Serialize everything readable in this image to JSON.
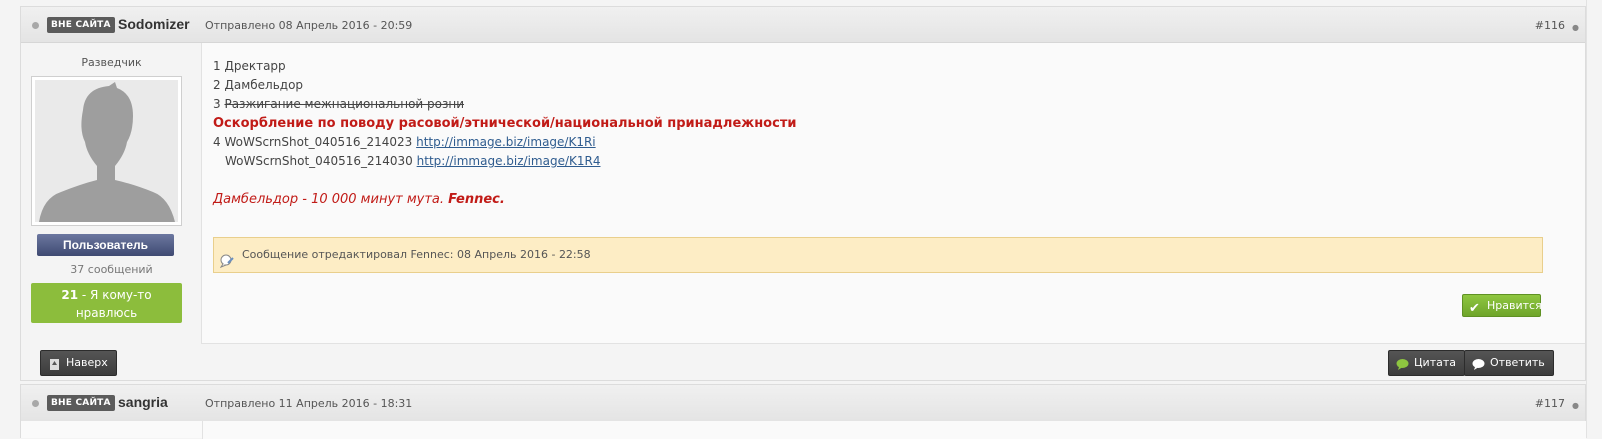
{
  "posts": [
    {
      "status_badge": "ВНЕ САЙТА",
      "author": "Sodomizer",
      "date": "Отправлено 08 Апрель 2016 - 20:59",
      "number": "#116",
      "rank": "Разведчик",
      "group": "Пользователь",
      "post_count": "37 сообщений",
      "reputation_count": "21",
      "reputation_text": "- Я кому-то нравлюсь",
      "content": {
        "line1_num": "1",
        "line1_text": "Дректарр",
        "line2_num": "2",
        "line2_text": "Дамбельдор",
        "line3_num": "3",
        "line3_text": "Разжигание межнациональной розни",
        "line4_text": "Оскорбление по поводу расовой/этнической/национальной принадлежности",
        "line5_num": "4",
        "line5_text": "WoWScrnShot_040516_214023",
        "line5_link": "http://immage.biz/image/K1Ri",
        "line6_text": "WoWScrnShot_040516_214030",
        "line6_link": "http://immage.biz/image/K1R4",
        "mod_note": "Дамбельдор - 10 000 минут мута.",
        "mod_name": "Fennec."
      },
      "edit_note": "Сообщение отредактировал Fennec: 08 Апрель 2016 - 22:58",
      "like_label": "Нравится",
      "top_label": "Наверх",
      "quote_label": "Цитата",
      "reply_label": "Ответить"
    },
    {
      "status_badge": "ВНЕ САЙТА",
      "author": "sangria",
      "date": "Отправлено 11 Апрель 2016 - 18:31",
      "number": "#117"
    }
  ],
  "colors": {
    "reputation": "#8cbd3c",
    "violation": "#c11b17",
    "edit_note_bg": "#fdedc5",
    "link": "#2f5c8f"
  }
}
